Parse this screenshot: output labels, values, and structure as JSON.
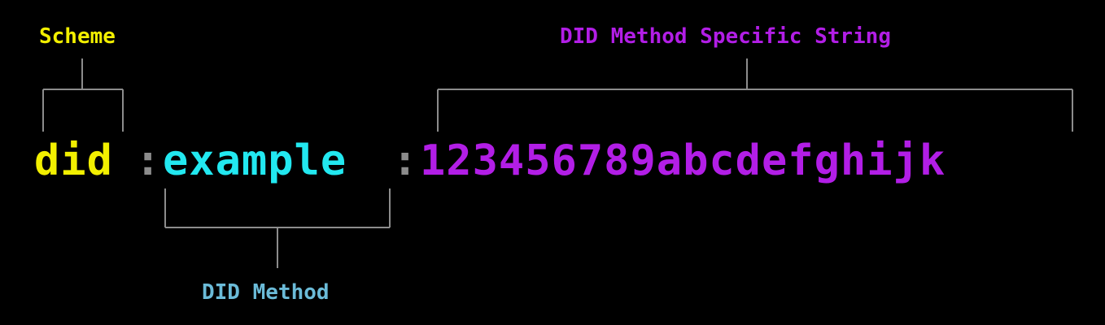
{
  "labels": {
    "scheme": "Scheme",
    "method": "DID Method",
    "specific": "DID Method Specific String"
  },
  "did": {
    "scheme": "did",
    "separator": ":",
    "method": "example",
    "specific": "123456789abcdefghijk"
  },
  "colors": {
    "background": "#000000",
    "scheme": "#f2ef00",
    "method": "#22e8f0",
    "method_label": "#6bbbd8",
    "specific": "#b21ee6",
    "bracket": "#8c8c8c"
  }
}
